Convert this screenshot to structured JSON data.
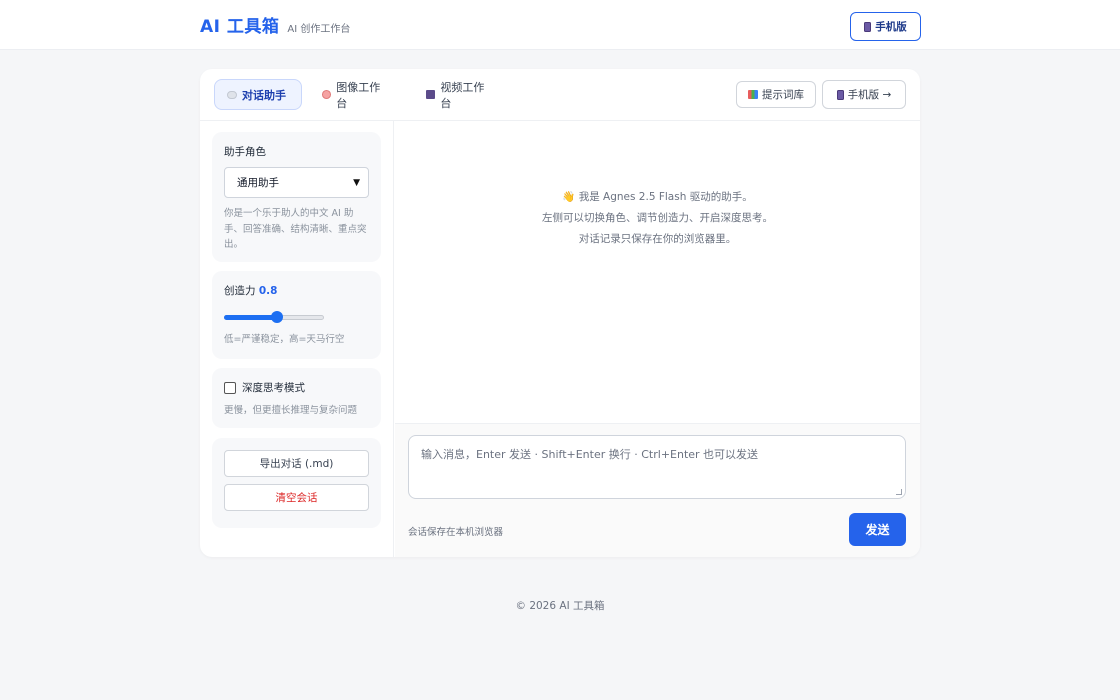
{
  "header": {
    "title": "AI 工具箱",
    "subtitle": "AI 创作工作台",
    "mobile_label": "手机版"
  },
  "tabs": [
    {
      "label": "对话助手",
      "icon": "speech-bubble-icon",
      "active": true
    },
    {
      "label": "图像工作台",
      "icon": "palette-icon",
      "active": false
    },
    {
      "label": "视频工作台",
      "icon": "film-icon",
      "active": false
    }
  ],
  "toolbar": {
    "prompts_label": "提示词库",
    "mobile_label": "手机版 →"
  },
  "sidebar": {
    "role": {
      "title": "助手角色",
      "selected": "通用助手",
      "help": "你是一个乐于助人的中文 AI 助手、回答准确、结构清晰、重点突出。"
    },
    "creativity": {
      "title": "创造力",
      "value": "0.8",
      "level": 0.53,
      "help": "低=严谨稳定，高=天马行空"
    },
    "deep_think": {
      "label": "深度思考模式",
      "checked": false,
      "help": "更慢，但更擅长推理与复杂问题"
    },
    "actions": {
      "export_label": "导出对话 (.md)",
      "clear_label": "清空会话"
    }
  },
  "chat": {
    "welcome": [
      "👋 我是 Agnes 2.5 Flash 驱动的助手。",
      "左侧可以切换角色、调节创造力、开启深度思考。",
      "对话记录只保存在你的浏览器里。"
    ],
    "input_placeholder": "输入消息，Enter 发送 · Shift+Enter 换行 · Ctrl+Enter 也可以发送",
    "note": "会话保存在本机浏览器",
    "send_label": "发送"
  },
  "footer": {
    "copyright": "© 2026 AI 工具箱"
  },
  "colors": {
    "accent": "#2563eb",
    "danger": "#dc2626",
    "background": "#f5f6f8"
  }
}
